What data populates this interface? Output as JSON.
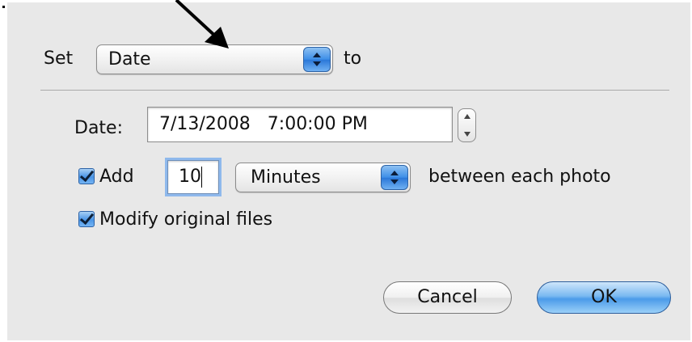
{
  "dialog": {
    "set_label": "Set",
    "set_value": "Date",
    "to_label": "to",
    "date_label": "Date:",
    "date_value": "7/13/2008   7:00:00 PM",
    "add_label": "Add",
    "add_value": "10",
    "unit_value": "Minutes",
    "between_label": "between each photo",
    "modify_label": "Modify original files",
    "cancel_label": "Cancel",
    "ok_label": "OK",
    "add_checked": true,
    "modify_checked": true
  },
  "icons": [
    "popup-arrows-icon",
    "stepper-arrows-icon",
    "checkmark-icon",
    "annotation-arrow-icon"
  ],
  "colors": {
    "background": "#e8e8e8",
    "accent_blue": "#4a95e6"
  }
}
